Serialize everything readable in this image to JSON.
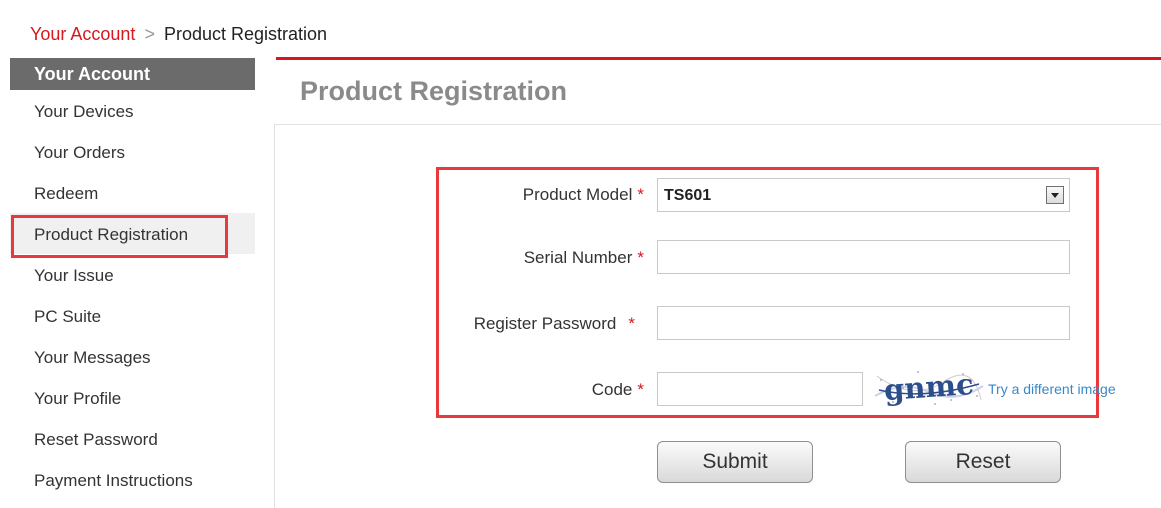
{
  "breadcrumb": {
    "link": "Your Account",
    "separator": ">",
    "current": "Product Registration"
  },
  "sidebar": {
    "header": "Your Account",
    "items": [
      {
        "label": "Your Devices"
      },
      {
        "label": "Your Orders"
      },
      {
        "label": "Redeem"
      },
      {
        "label": "Product Registration"
      },
      {
        "label": "Your Issue"
      },
      {
        "label": "PC Suite"
      },
      {
        "label": "Your Messages"
      },
      {
        "label": "Your Profile"
      },
      {
        "label": "Reset Password"
      },
      {
        "label": "Payment Instructions"
      }
    ],
    "active_index": 3
  },
  "main": {
    "title": "Product Registration"
  },
  "form": {
    "required_marker": "*",
    "product_model": {
      "label": "Product Model",
      "value": "TS601"
    },
    "serial_number": {
      "label": "Serial Number",
      "value": ""
    },
    "register_password": {
      "label": "Register Password",
      "value": ""
    },
    "code": {
      "label": "Code",
      "value": ""
    },
    "captcha_image_text": "gnmc",
    "captcha_link": "Try a different image",
    "submit_label": "Submit",
    "reset_label": "Reset"
  },
  "colors": {
    "accent": "#d8171e",
    "highlight_outline": "#e8393f",
    "sidebar_header_bg": "#6b6b6b",
    "link": "#3a87c8",
    "captcha_text": "#2d4e8a"
  }
}
